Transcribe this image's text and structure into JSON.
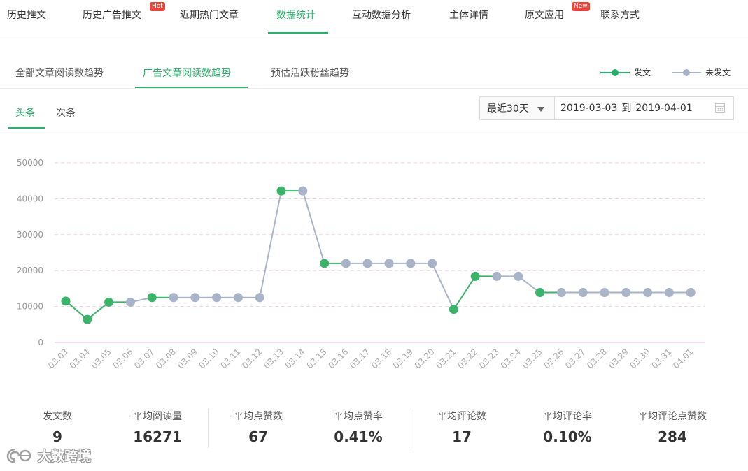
{
  "top_nav": {
    "items": [
      "历史推文",
      "历史广告推文",
      "近期热门文章",
      "数据统计",
      "互动数据分析",
      "主体详情",
      "原文应用",
      "联系方式"
    ],
    "active": "数据统计",
    "hot_badge": "Hot",
    "new_badge": "New"
  },
  "sub_tabs": {
    "items": [
      "全部文章阅读数趋势",
      "广告文章阅读数趋势",
      "预估活跃粉丝趋势"
    ],
    "active": "广告文章阅读数趋势"
  },
  "third_tabs": {
    "items": [
      "头条",
      "次条"
    ],
    "active": "头条"
  },
  "range": {
    "selected": "最近30天",
    "start": "2019-03-03",
    "separator": "到",
    "end": "2019-04-01"
  },
  "colors": {
    "accent": "#2bb06b",
    "posted": "#3bb36a",
    "not_posted": "#aab4c8",
    "badge": "#e8453c"
  },
  "chart_data": {
    "type": "line",
    "legend": [
      "发文",
      "未发文"
    ],
    "legend_position": "top-right",
    "categories": [
      "03.03",
      "03.04",
      "03.05",
      "03.06",
      "03.07",
      "03.08",
      "03.09",
      "03.10",
      "03.11",
      "03.12",
      "03.13",
      "03.14",
      "03.15",
      "03.16",
      "03.17",
      "03.18",
      "03.19",
      "03.20",
      "03.21",
      "03.22",
      "03.23",
      "03.24",
      "03.25",
      "03.26",
      "03.27",
      "03.28",
      "03.29",
      "03.30",
      "03.31",
      "04.01"
    ],
    "values": [
      11500,
      6400,
      11200,
      11200,
      12500,
      12500,
      12500,
      12500,
      12500,
      12500,
      42200,
      42200,
      22000,
      22000,
      22000,
      22000,
      22000,
      22000,
      9200,
      18400,
      18400,
      18400,
      13900,
      13900,
      13900,
      13900,
      13900,
      13900,
      13900,
      13900
    ],
    "posted": [
      true,
      true,
      true,
      false,
      true,
      false,
      false,
      false,
      false,
      false,
      true,
      false,
      true,
      false,
      false,
      false,
      false,
      false,
      true,
      true,
      false,
      false,
      true,
      false,
      false,
      false,
      false,
      false,
      false,
      false
    ],
    "yticks": [
      "0",
      "10000",
      "20000",
      "30000",
      "40000",
      "50000"
    ],
    "ylim": [
      0,
      50000
    ],
    "grid": "dashed horizontal"
  },
  "stats": [
    {
      "label": "发文数",
      "value": "9"
    },
    {
      "label": "平均阅读量",
      "value": "16271"
    },
    {
      "label": "平均点赞数",
      "value": "67"
    },
    {
      "label": "平均点赞率",
      "value": "0.41%"
    },
    {
      "label": "平均评论数",
      "value": "17"
    },
    {
      "label": "平均评论率",
      "value": "0.10%"
    },
    {
      "label": "平均评论点赞数",
      "value": "284"
    }
  ],
  "watermark": {
    "text": "大数跨境"
  }
}
